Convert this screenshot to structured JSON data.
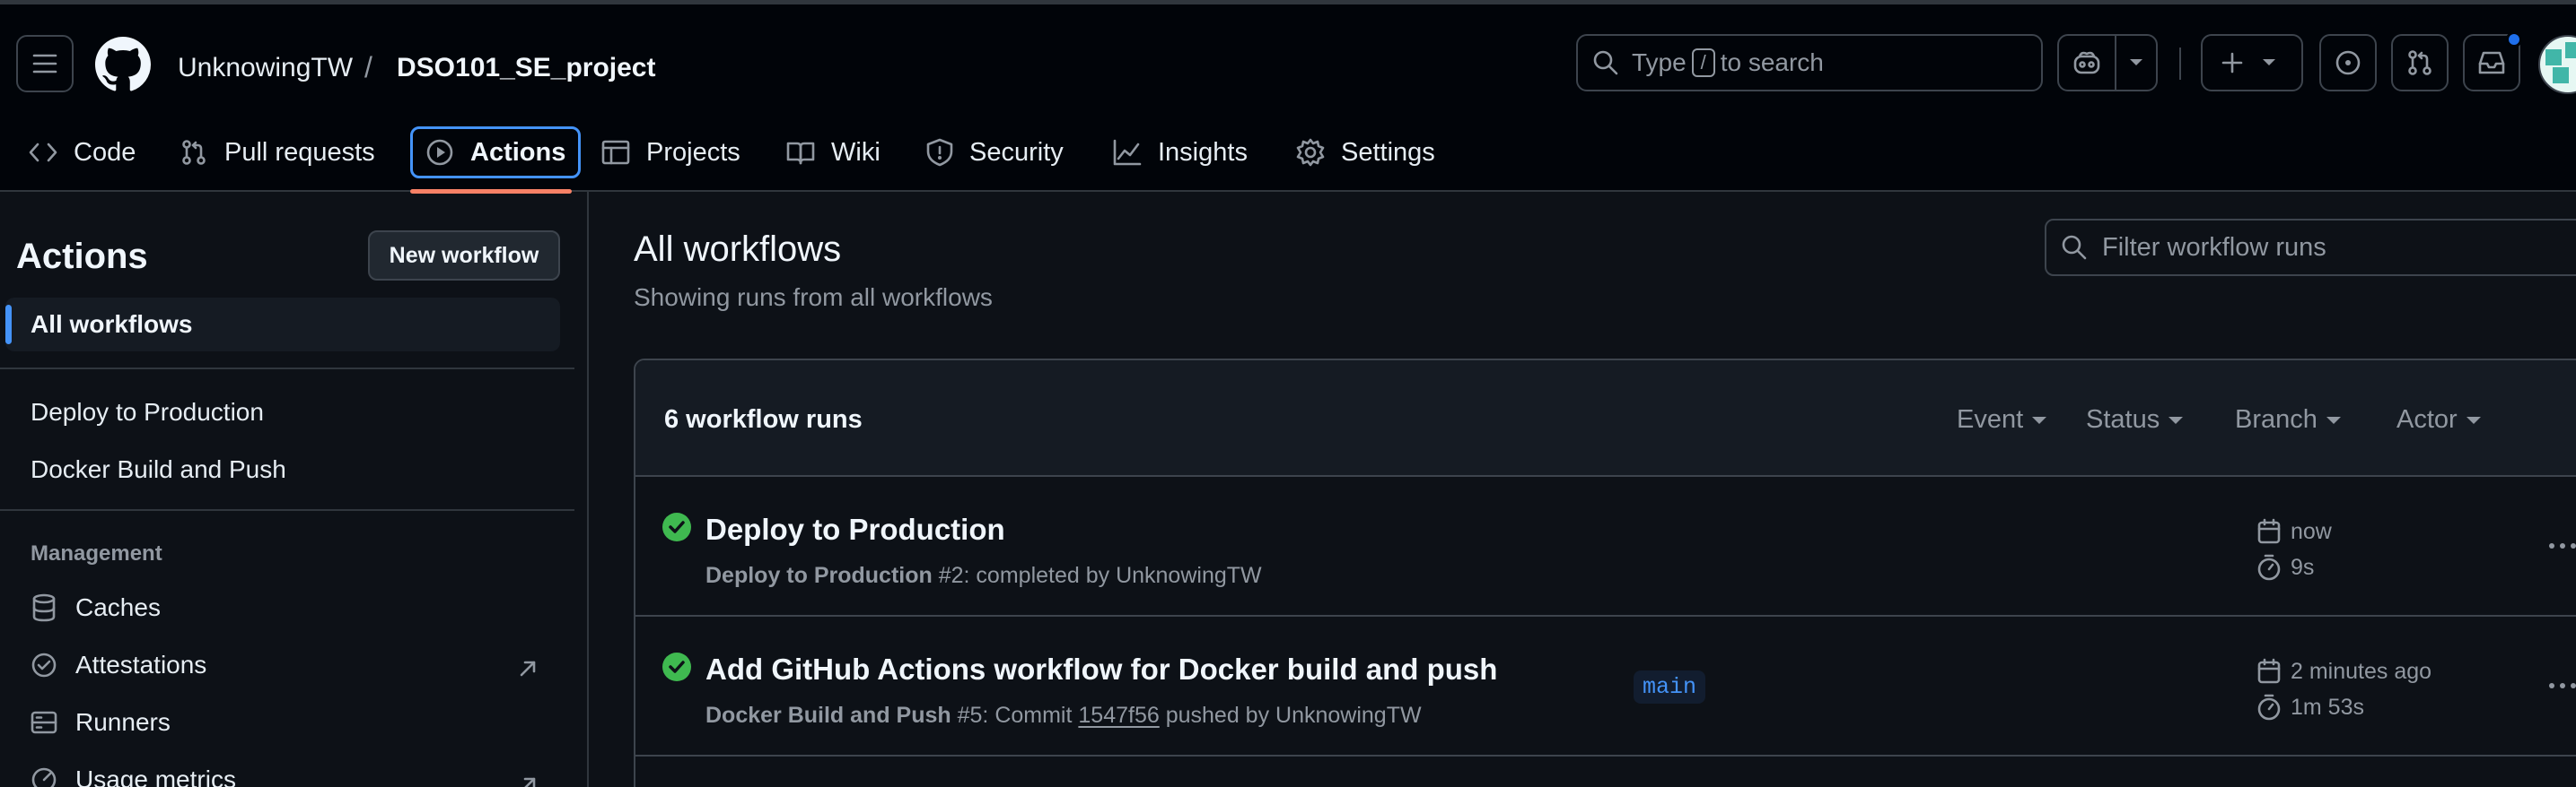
{
  "header": {
    "owner": "UnknowingTW",
    "separator": "/",
    "repo": "DSO101_SE_project",
    "search_prefix": "Type",
    "search_key": "/",
    "search_suffix": "to search"
  },
  "tabs": [
    {
      "label": "Code",
      "icon": "code-icon"
    },
    {
      "label": "Pull requests",
      "icon": "pull-request-icon"
    },
    {
      "label": "Actions",
      "icon": "play-icon",
      "active": true
    },
    {
      "label": "Projects",
      "icon": "table-icon"
    },
    {
      "label": "Wiki",
      "icon": "book-icon"
    },
    {
      "label": "Security",
      "icon": "shield-icon"
    },
    {
      "label": "Insights",
      "icon": "graph-icon"
    },
    {
      "label": "Settings",
      "icon": "gear-icon"
    }
  ],
  "sidebar": {
    "title": "Actions",
    "new_workflow": "New workflow",
    "all_workflows": "All workflows",
    "workflows": [
      "Deploy to Production",
      "Docker Build and Push"
    ],
    "management_heading": "Management",
    "management": [
      {
        "label": "Caches",
        "icon": "database-icon"
      },
      {
        "label": "Attestations",
        "icon": "verified-icon",
        "external": true
      },
      {
        "label": "Runners",
        "icon": "server-icon"
      },
      {
        "label": "Usage metrics",
        "icon": "meter-icon",
        "external": true
      }
    ]
  },
  "main": {
    "title": "All workflows",
    "subtitle": "Showing runs from all workflows",
    "filter_placeholder": "Filter workflow runs",
    "runs_count": "6 workflow runs",
    "filters": [
      "Event",
      "Status",
      "Branch",
      "Actor"
    ],
    "runs": [
      {
        "title": "Deploy to Production",
        "workflow": "Deploy to Production",
        "detail": "#2: completed by UnknowingTW",
        "commit": "",
        "detail_suffix": "",
        "branch": "",
        "time": "now",
        "duration": "9s",
        "status": "success"
      },
      {
        "title": "Add GitHub Actions workflow for Docker build and push",
        "workflow": "Docker Build and Push",
        "detail": "#5: Commit",
        "commit": "1547f56",
        "detail_suffix": "pushed by UnknowingTW",
        "branch": "main",
        "time": "2 minutes ago",
        "duration": "1m 53s",
        "status": "success"
      }
    ]
  },
  "colors": {
    "accent": "#4493f8",
    "success": "#3fb950",
    "active_tab_underline": "#f78166"
  }
}
